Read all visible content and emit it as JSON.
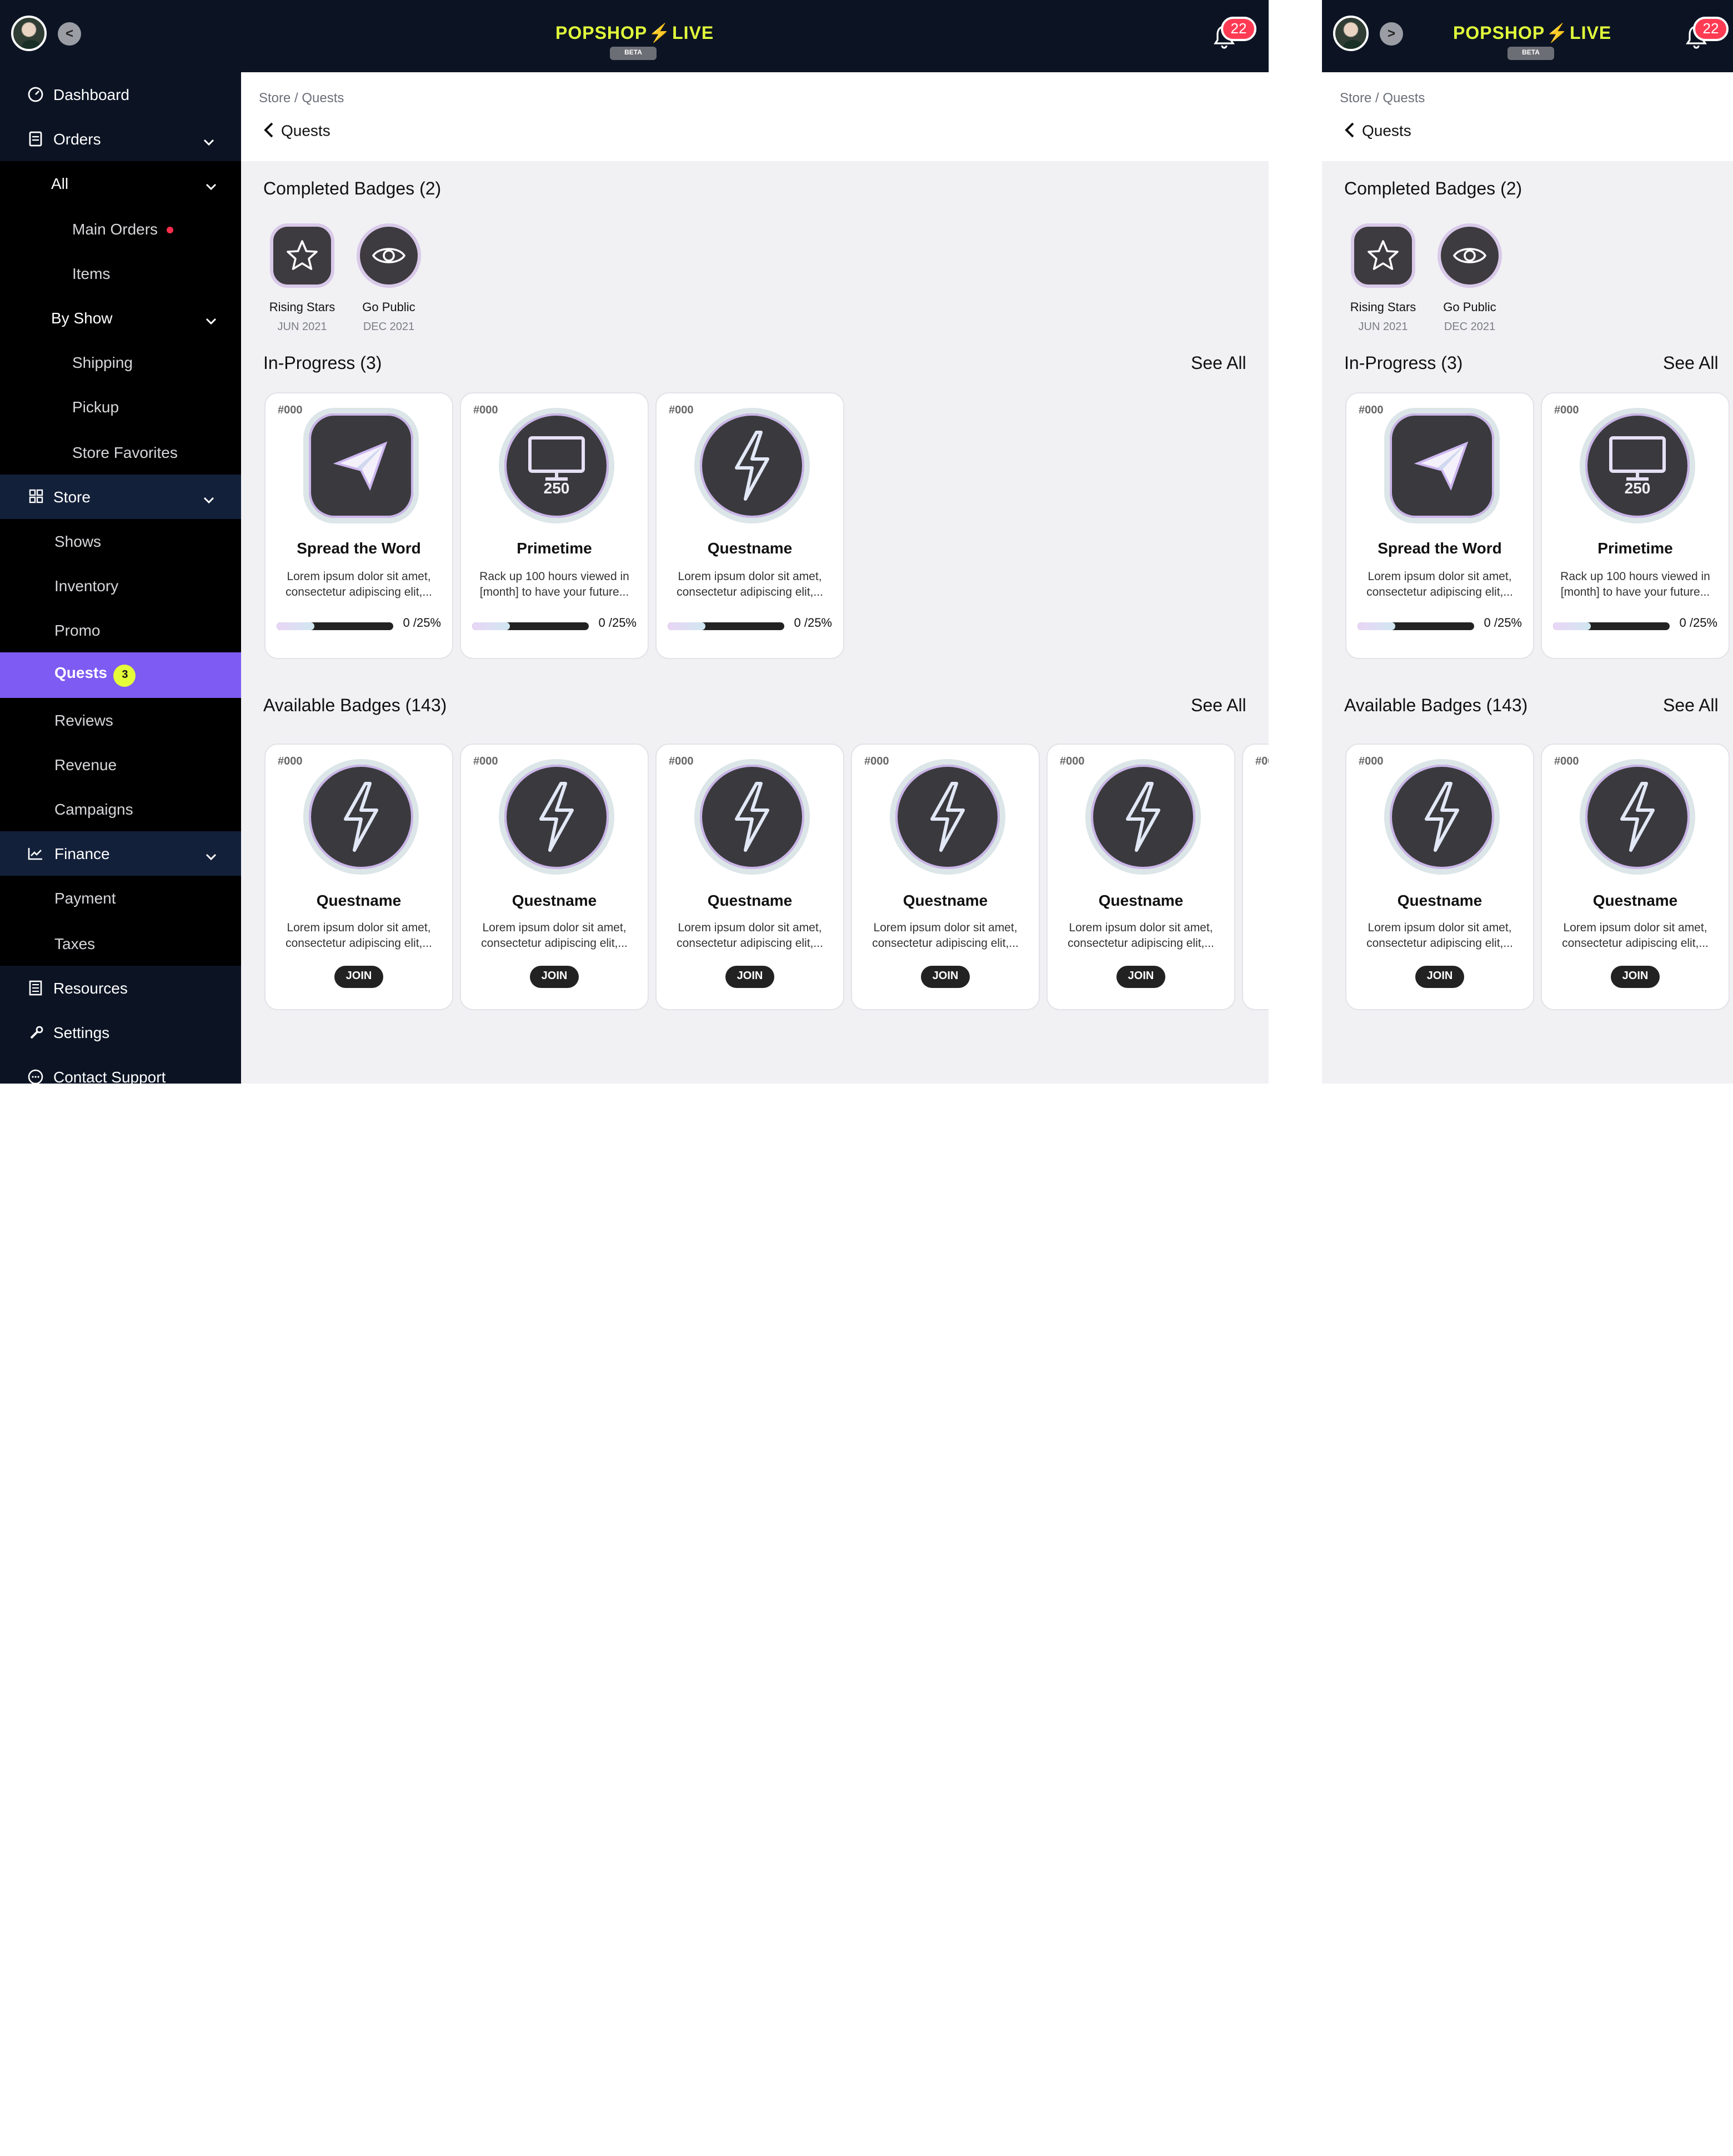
{
  "brand": {
    "logo_left": "POPSHOP",
    "logo_right": "LIVE",
    "beta": "BETA",
    "accent": "#e2ff3a",
    "active": "#7e5bf2"
  },
  "notifications": {
    "count": "22"
  },
  "sidebar": {
    "items": [
      {
        "label": "Dashboard",
        "icon": "dashboard-icon"
      },
      {
        "label": "Orders",
        "icon": "orders-icon"
      },
      {
        "label": "All"
      },
      {
        "label": "Main Orders"
      },
      {
        "label": "Items"
      },
      {
        "label": "By Show"
      },
      {
        "label": "Shipping"
      },
      {
        "label": "Pickup"
      },
      {
        "label": "Store Favorites"
      },
      {
        "label": "Store",
        "icon": "grid-icon"
      },
      {
        "label": "Shows"
      },
      {
        "label": "Inventory"
      },
      {
        "label": "Promo"
      },
      {
        "label": "Quests",
        "badge": "3"
      },
      {
        "label": "Reviews"
      },
      {
        "label": "Revenue"
      },
      {
        "label": "Campaigns"
      },
      {
        "label": "Finance",
        "icon": "chart-icon"
      },
      {
        "label": "Payment"
      },
      {
        "label": "Taxes"
      },
      {
        "label": "Resources",
        "icon": "resources-icon"
      },
      {
        "label": "Settings",
        "icon": "wrench-icon"
      },
      {
        "label": "Contact Support",
        "icon": "chat-icon"
      }
    ]
  },
  "breadcrumb": "Store / Quests",
  "page_title": "Quests",
  "completed": {
    "title": "Completed Badges (2)",
    "badges": [
      {
        "name": "Rising Stars",
        "date": "JUN 2021",
        "icon": "star-icon"
      },
      {
        "name": "Go Public",
        "date": "DEC 2021",
        "icon": "eye-icon"
      }
    ]
  },
  "in_progress": {
    "title": "In-Progress (3)",
    "see_all": "See All",
    "cards": [
      {
        "num": "#000",
        "title": "Spread the Word",
        "desc": "Lorem ipsum dolor sit amet, consectetur adipiscing elit,...",
        "progress": "0 /25%",
        "icon": "paper-plane-icon",
        "fill": 0.32
      },
      {
        "num": "#000",
        "title": "Primetime",
        "desc": "Rack up 100 hours viewed in [month] to have your future...",
        "progress": "0 /25%",
        "icon": "monitor-icon",
        "medal_text": "250",
        "fill": 0.32
      },
      {
        "num": "#000",
        "title": "Questname",
        "desc": "Lorem ipsum dolor sit amet, consectetur adipiscing elit,...",
        "progress": "0 /25%",
        "icon": "lightning-icon",
        "fill": 0.32
      }
    ]
  },
  "available": {
    "title": "Available Badges (143)",
    "see_all": "See All",
    "cards": [
      {
        "num": "#000",
        "title": "Questname",
        "desc": "Lorem ipsum dolor sit amet, consectetur adipiscing elit,...",
        "join": "JOIN"
      },
      {
        "num": "#000",
        "title": "Questname",
        "desc": "Lorem ipsum dolor sit amet, consectetur adipiscing elit,...",
        "join": "JOIN"
      },
      {
        "num": "#000",
        "title": "Questname",
        "desc": "Lorem ipsum dolor sit amet, consectetur adipiscing elit,...",
        "join": "JOIN"
      },
      {
        "num": "#000",
        "title": "Questname",
        "desc": "Lorem ipsum dolor sit amet, consectetur adipiscing elit,...",
        "join": "JOIN"
      },
      {
        "num": "#000",
        "title": "Questname",
        "desc": "Lorem ipsum dolor sit amet, consectetur adipiscing elit,...",
        "join": "JOIN"
      }
    ]
  }
}
